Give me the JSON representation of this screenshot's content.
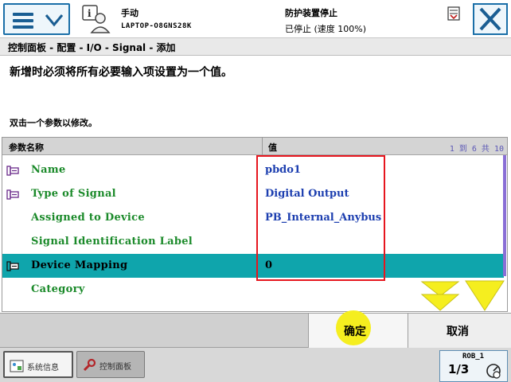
{
  "header": {
    "mode": "手动",
    "host": "LAPTOP-O8GNS28K",
    "guard_status": "防护装置停止",
    "run_status": "已停止 (速度 100%)"
  },
  "breadcrumb": "控制面板 - 配置 - I/O - Signal - 添加",
  "instruction": "新增时必须将所有必要输入项设置为一个值。",
  "hint": "双击一个参数以修改。",
  "table": {
    "col_name": "参数名称",
    "col_value": "值",
    "range": "1 到 6 共 10",
    "rows": [
      {
        "name": "Name",
        "value": "pbdo1",
        "icon": "parameter-icon"
      },
      {
        "name": "Type of Signal",
        "value": "Digital Output",
        "icon": "parameter-icon"
      },
      {
        "name": "Assigned to Device",
        "value": "PB_Internal_Anybus",
        "icon": ""
      },
      {
        "name": "Signal Identification Label",
        "value": "",
        "icon": ""
      },
      {
        "name": "Device Mapping",
        "value": "0",
        "icon": "parameter-icon"
      },
      {
        "name": "Category",
        "value": "",
        "icon": ""
      }
    ]
  },
  "actions": {
    "ok": "确定",
    "cancel": "取消"
  },
  "taskbar": {
    "task1": "系统信息",
    "task2": "控制面板"
  },
  "quickset": {
    "robot": "ROB_1",
    "fraction": "1/3"
  },
  "colors": {
    "selected_row": "#0fa5ac",
    "name_text": "#1b8a2a",
    "value_text": "#1d3fb0",
    "highlight": "#e6161e",
    "frame_blue": "#1a6fa8"
  }
}
